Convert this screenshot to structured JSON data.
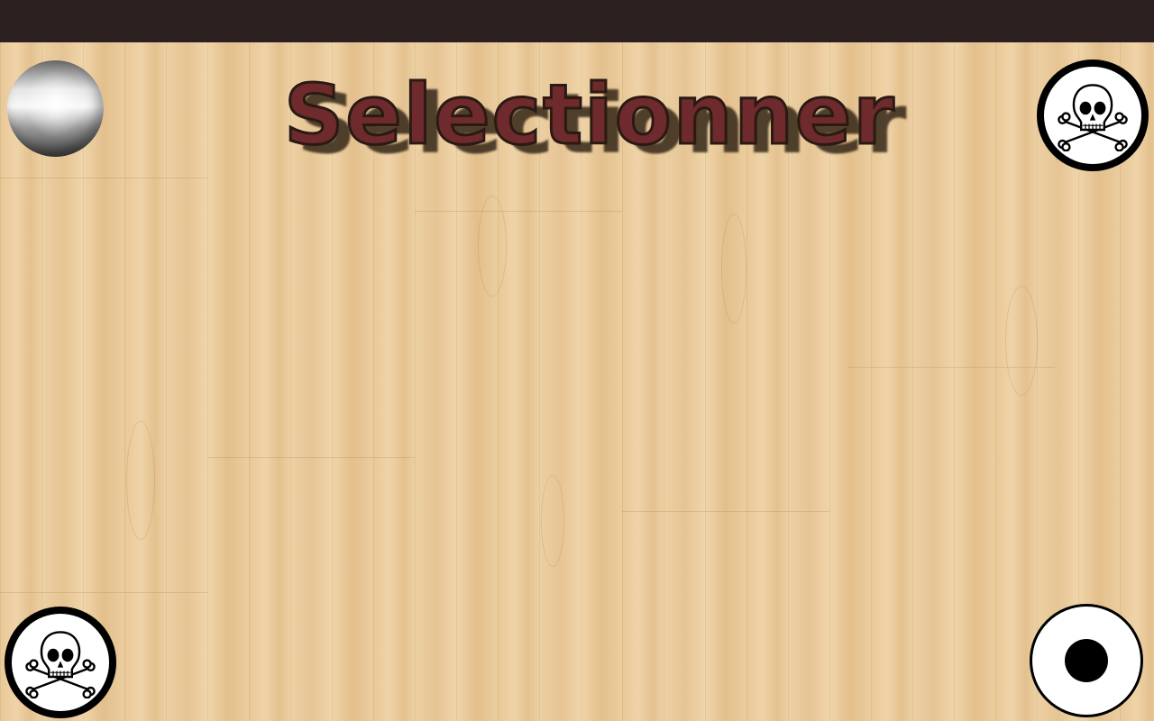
{
  "screen": {
    "title": "Selectionner"
  },
  "controls": {
    "marble": {
      "icon": "silver-marble-icon"
    },
    "top_right_button": {
      "icon": "skull-crossbones-icon"
    },
    "bottom_left_button": {
      "icon": "skull-crossbones-icon"
    },
    "bottom_right_button": {
      "icon": "record-dot-icon"
    }
  },
  "colors": {
    "status_bar": "#2c1f20",
    "wood_floor": "#e8c596",
    "title_fill": "#6e2a2c"
  }
}
